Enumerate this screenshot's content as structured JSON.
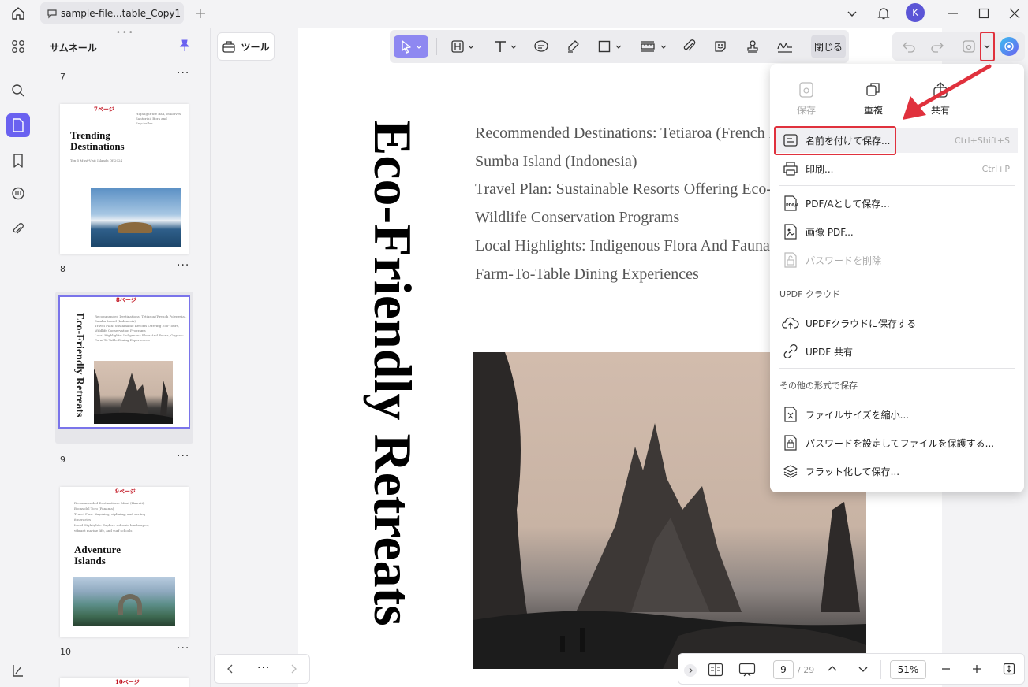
{
  "titlebar": {
    "tab_title": "sample-file...table_Copy1",
    "avatar_initial": "K"
  },
  "thumbnails": {
    "title": "サムネール",
    "pages": [
      {
        "num": "7"
      },
      {
        "num": "8",
        "tag": "7ページ",
        "heading_line1": "Trending",
        "heading_line2": "Destinations",
        "sub": "Top 5 Must-Visit Islands Of 2024",
        "small": "Highlight the Bali, Maldives, Santorini, Bora and Seychelles"
      },
      {
        "num": "9",
        "tag": "8ページ",
        "heading": "Eco-Friendly Retreats",
        "lines": [
          "Recommended Destinations: Tetiaroa (French Polynesia),",
          "Sumba Island (Indonesia)",
          "Travel Plan: Sustainable Resorts Offering Eco-Tours,",
          "Wildlife Conservation Programs",
          "Local Highlights: Indigenous Flora And Fauna, Organic",
          "Farm-To-Table Dining Experiences"
        ]
      },
      {
        "num": "10",
        "tag": "9ページ",
        "heading_line1": "Adventure",
        "heading_line2": "Islands",
        "lines": [
          "Recommended Destinations: Maui (Hawaii),",
          "Bocas del Toro (Panama)",
          "Travel Plan: Kayaking, ziplining, and surfing",
          "itineraries",
          "Local Highlights: Explore volcanic landscapes,",
          "vibrant marine life, and surf schools"
        ]
      },
      {
        "tag": "10ページ"
      }
    ]
  },
  "tools_label": "ツール",
  "toolbar": {
    "close_label": "閉じる"
  },
  "document": {
    "vertical_title": "Eco-Friendly Retreats",
    "lines": [
      "Recommended Destinations: Tetiaroa (French Polynesia),",
      "Sumba Island (Indonesia)",
      "Travel Plan: Sustainable Resorts Offering Eco-Tours,",
      "Wildlife Conservation Programs",
      "Local Highlights: Indigenous Flora And Fauna, Organic",
      "Farm-To-Table Dining Experiences"
    ]
  },
  "menu": {
    "top_actions": {
      "save": "保存",
      "duplicate": "重複",
      "share": "共有"
    },
    "save_as": {
      "label": "名前を付けて保存...",
      "shortcut": "Ctrl+Shift+S"
    },
    "print": {
      "label": "印刷...",
      "shortcut": "Ctrl+P"
    },
    "save_pdfa": "PDF/Aとして保存...",
    "image_pdf": "画像 PDF...",
    "remove_password": "パスワードを削除",
    "cloud_header": "UPDF クラウド",
    "save_cloud": "UPDFクラウドに保存する",
    "updf_share": "UPDF 共有",
    "other_header": "その他の形式で保存",
    "reduce_size": "ファイルサイズを縮小...",
    "protect_password": "パスワードを設定してファイルを保護する...",
    "flatten_save": "フラット化して保存..."
  },
  "pagebar": {
    "current_page": "9",
    "total_pages": "/ 29",
    "zoom": "51%"
  },
  "colors": {
    "accent": "#6a61f0",
    "highlight": "#e0313d"
  }
}
